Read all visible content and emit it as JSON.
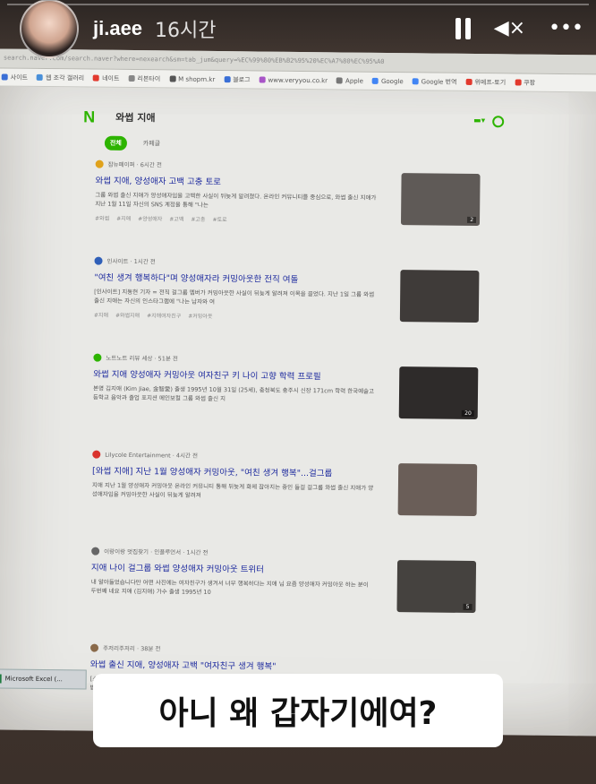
{
  "story": {
    "username": "ji.aee",
    "time_ago": "16시간",
    "progress": 0.0,
    "caption": "아니 왜 갑자기에여?",
    "icons": [
      "pause-icon",
      "mute-icon",
      "more-icon"
    ]
  },
  "browser": {
    "url": "search.naver.com/search.naver?where=nexearch&sm=tab_jum&query=%EC%99%80%EB%B2%95%20%EC%A7%80%EC%95%A0",
    "bookmarks": [
      {
        "label": "사이트",
        "color": "#3a6fd6"
      },
      {
        "label": "웹 조각 갤러리",
        "color": "#4a90d9"
      },
      {
        "label": "네이트",
        "color": "#e23a2e"
      },
      {
        "label": "리본타이",
        "color": "#888888"
      },
      {
        "label": "M shopm.kr",
        "color": "#555555"
      },
      {
        "label": "블로그",
        "color": "#3a6fd6"
      },
      {
        "label": "www.veryyou.co.kr",
        "color": "#a855c7"
      },
      {
        "label": "Apple",
        "color": "#777777"
      },
      {
        "label": "Google",
        "color": "#4285f4"
      },
      {
        "label": "Google 번역",
        "color": "#4285f4"
      },
      {
        "label": "위메프-토기",
        "color": "#e23a2e"
      },
      {
        "label": "쿠팡",
        "color": "#e23a2e"
      }
    ]
  },
  "naver": {
    "logo": "N",
    "query": "와썹 지애",
    "tabs": [
      {
        "label": "전체",
        "active": true
      },
      {
        "label": "카페글",
        "active": false
      }
    ]
  },
  "results": [
    {
      "source": "잡뉴페이퍼 · 6시간 전",
      "title": "와썹 지애, 양성애자 고백 고충 토로",
      "body": "그룹 와썹 출신 지애가 양성애자임을 고백한 사실이 뒤늦게 알려졌다. 온라인 커뮤니티를 중심으로, 와썹 출신 지애가 지난 1월 11일 자신의 SNS 계정을 통해 \"나는",
      "tags": [
        "#와썹",
        "#지애",
        "#양성애자",
        "#고백",
        "#고충",
        "#토로"
      ],
      "thumb_count": "2",
      "color": "#e0a21c"
    },
    {
      "source": "인사이트 · 1시간 전",
      "title": "\"여친 생겨 행복하다\"며 양성애자라 커밍아웃한 전직 여돌",
      "body": "[인사이트] 지동현 기자 = 전직 걸그룹 멤버가 커밍아웃한 사실이 뒤늦게 알려져 이목을 끌었다. 지난 1일 그룹 와썹 출신 지애는 자신의 인스타그램에 \"나는 남자와 여",
      "tags": [
        "#지애",
        "#와썹지애",
        "#지애여자친구",
        "#커밍아웃"
      ],
      "thumb_count": "",
      "color": "#2f5fb8"
    },
    {
      "source": "노트노트 리뷰 세상 · 51분 전",
      "title": "와썹 지애 양성애자 커밍아웃 여자친구 키 나이 고향 학력 프로필",
      "body": "본명 김지애 (Kim Jiae, 金智愛) 출생 1995년 10월 31일 (25세), 충청북도 충주시 신장 171cm 학력 한국예술고등학교 음악과 졸업 포지션 메인보컬 그룹 와썹 출신 지",
      "tags": [],
      "thumb_count": "20",
      "color": "#2db400"
    },
    {
      "source": "Lilycole Entertainment · 4시간 전",
      "title": "[와썹 지애] 지난 1월 양성애자 커밍아웃, \"여친 생겨 행복\"...걸그룹",
      "body": "지애 지난 1월 양성애자 커밍아웃 온라인 커뮤니티 통해 뒤늦게 화제 잠아지는 중인 들걸 걸그룹 와썹 출신 지애가 양성애자임을 커밍아웃한 사실이 뒤늦게 알려져",
      "tags": [],
      "thumb_count": "",
      "color": "#d9322c"
    },
    {
      "source": "이랑이랑 멋집찾기 · 인플루언서 · 1시간 전",
      "title": "지애 나이 걸그룹 와썹 양성애자 커밍아웃 트위터",
      "body": "내 알아들었습니다만 어떤 사진에는 여자친구가 생겨서 너무 행복하다는 지애 님 요즘 양성애자 커밍아웃 하는 분이 두번째 네요 지애 (김지애) 가수 출생 1995년 10",
      "tags": [],
      "thumb_count": "5",
      "color": "#666666"
    },
    {
      "source": "주저리주저리 · 38분 전",
      "title": "와썹 출신 지애, 양성애자 고백 \"여자친구 생겨 행복\"",
      "body": "[스타뉴스 윤성열 기자] /사진=지애 인스타그램 걸 그룹 와썹 출신 지애가 양성애자임을 고백한 사실이 뒤늦게 주목 받고 있다. 지난 17일 한 온라인 커뮤니티에는 '커밍아웃한 걸그룹 와썹 출신 지애'라는 제목의...",
      "tags": [],
      "thumb_count": "",
      "color": "#8a6a4a"
    }
  ],
  "taskbar": {
    "item_label": "Microsoft Excel (..."
  }
}
